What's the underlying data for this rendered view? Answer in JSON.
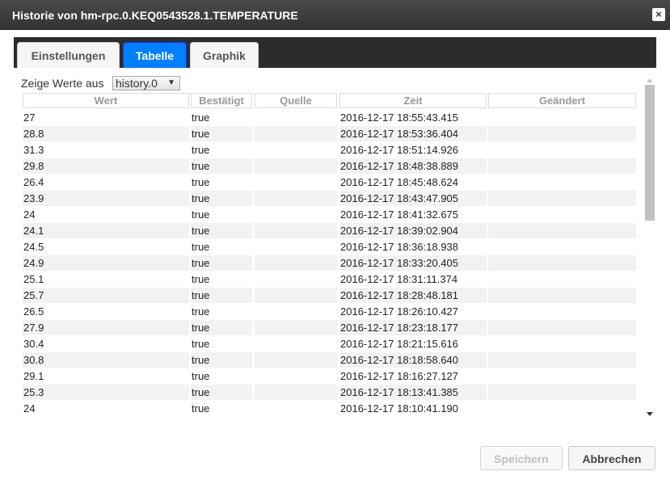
{
  "window": {
    "title": "Historie von hm-rpc.0.KEQ0543528.1.TEMPERATURE",
    "close_icon": "×"
  },
  "tabs": [
    {
      "label": "Einstellungen",
      "active": false
    },
    {
      "label": "Tabelle",
      "active": true
    },
    {
      "label": "Graphik",
      "active": false
    }
  ],
  "filter": {
    "label": "Zeige Werte aus",
    "selected": "history.0",
    "arrow": "▼"
  },
  "table": {
    "columns": [
      "Wert",
      "Bestätigt",
      "Quelle",
      "Zeit",
      "Geändert"
    ],
    "rows": [
      [
        "27",
        "true",
        "",
        "2016-12-17 18:55:43.415",
        ""
      ],
      [
        "28.8",
        "true",
        "",
        "2016-12-17 18:53:36.404",
        ""
      ],
      [
        "31.3",
        "true",
        "",
        "2016-12-17 18:51:14.926",
        ""
      ],
      [
        "29.8",
        "true",
        "",
        "2016-12-17 18:48:38.889",
        ""
      ],
      [
        "26.4",
        "true",
        "",
        "2016-12-17 18:45:48.624",
        ""
      ],
      [
        "23.9",
        "true",
        "",
        "2016-12-17 18:43:47.905",
        ""
      ],
      [
        "24",
        "true",
        "",
        "2016-12-17 18:41:32.675",
        ""
      ],
      [
        "24.1",
        "true",
        "",
        "2016-12-17 18:39:02.904",
        ""
      ],
      [
        "24.5",
        "true",
        "",
        "2016-12-17 18:36:18.938",
        ""
      ],
      [
        "24.9",
        "true",
        "",
        "2016-12-17 18:33:20.405",
        ""
      ],
      [
        "25.1",
        "true",
        "",
        "2016-12-17 18:31:11.374",
        ""
      ],
      [
        "25.7",
        "true",
        "",
        "2016-12-17 18:28:48.181",
        ""
      ],
      [
        "26.5",
        "true",
        "",
        "2016-12-17 18:26:10.427",
        ""
      ],
      [
        "27.9",
        "true",
        "",
        "2016-12-17 18:23:18.177",
        ""
      ],
      [
        "30.4",
        "true",
        "",
        "2016-12-17 18:21:15.616",
        ""
      ],
      [
        "30.8",
        "true",
        "",
        "2016-12-17 18:18:58.640",
        ""
      ],
      [
        "29.1",
        "true",
        "",
        "2016-12-17 18:16:27.127",
        ""
      ],
      [
        "25.3",
        "true",
        "",
        "2016-12-17 18:13:41.385",
        ""
      ],
      [
        "24",
        "true",
        "",
        "2016-12-17 18:10:41.190",
        ""
      ]
    ]
  },
  "buttons": {
    "save": "Speichern",
    "cancel": "Abbrechen"
  },
  "colors": {
    "titlebar": "#333333",
    "active_tab": "#007fff",
    "tabbar": "#2c2c2c"
  }
}
